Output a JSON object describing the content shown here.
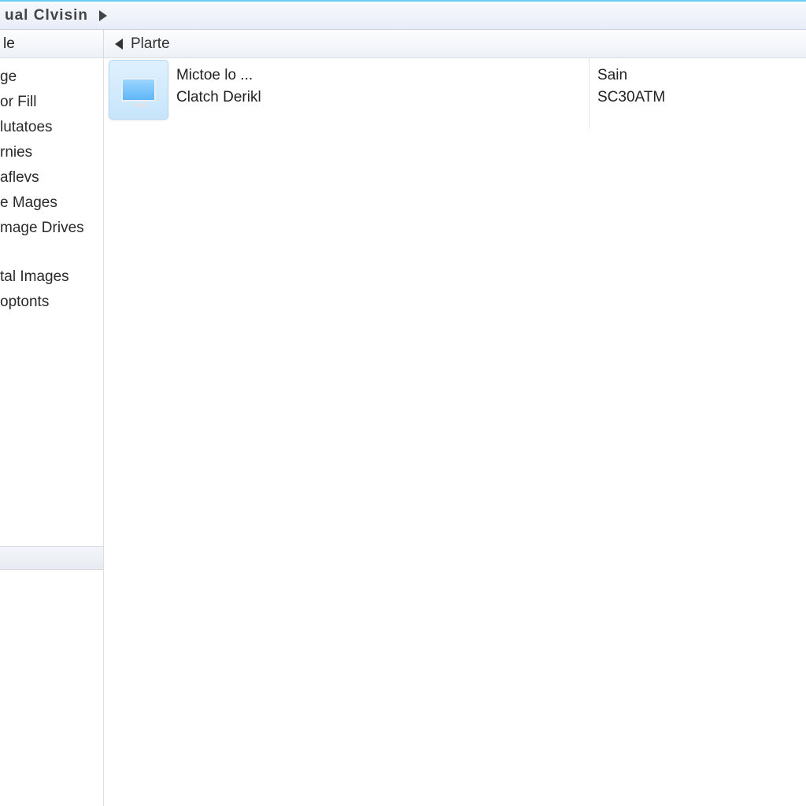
{
  "title": "ual Clvisin",
  "toolbar": {
    "left_label": "le",
    "crumb": "Plarte"
  },
  "sidebar": {
    "group1": [
      "ge",
      "or Fill",
      "lutatoes",
      "rnies",
      "aflevs",
      "e Mages",
      "mage Drives"
    ],
    "group2": [
      "tal Images",
      "optonts"
    ],
    "group3": [
      ""
    ]
  },
  "content": {
    "item": {
      "line1": "Mictoe lo ...",
      "line2": "Clatch Derikl"
    },
    "right": {
      "line1": "Sain",
      "line2": "SC30ATM"
    },
    "icon_name": "monitor-icon"
  }
}
